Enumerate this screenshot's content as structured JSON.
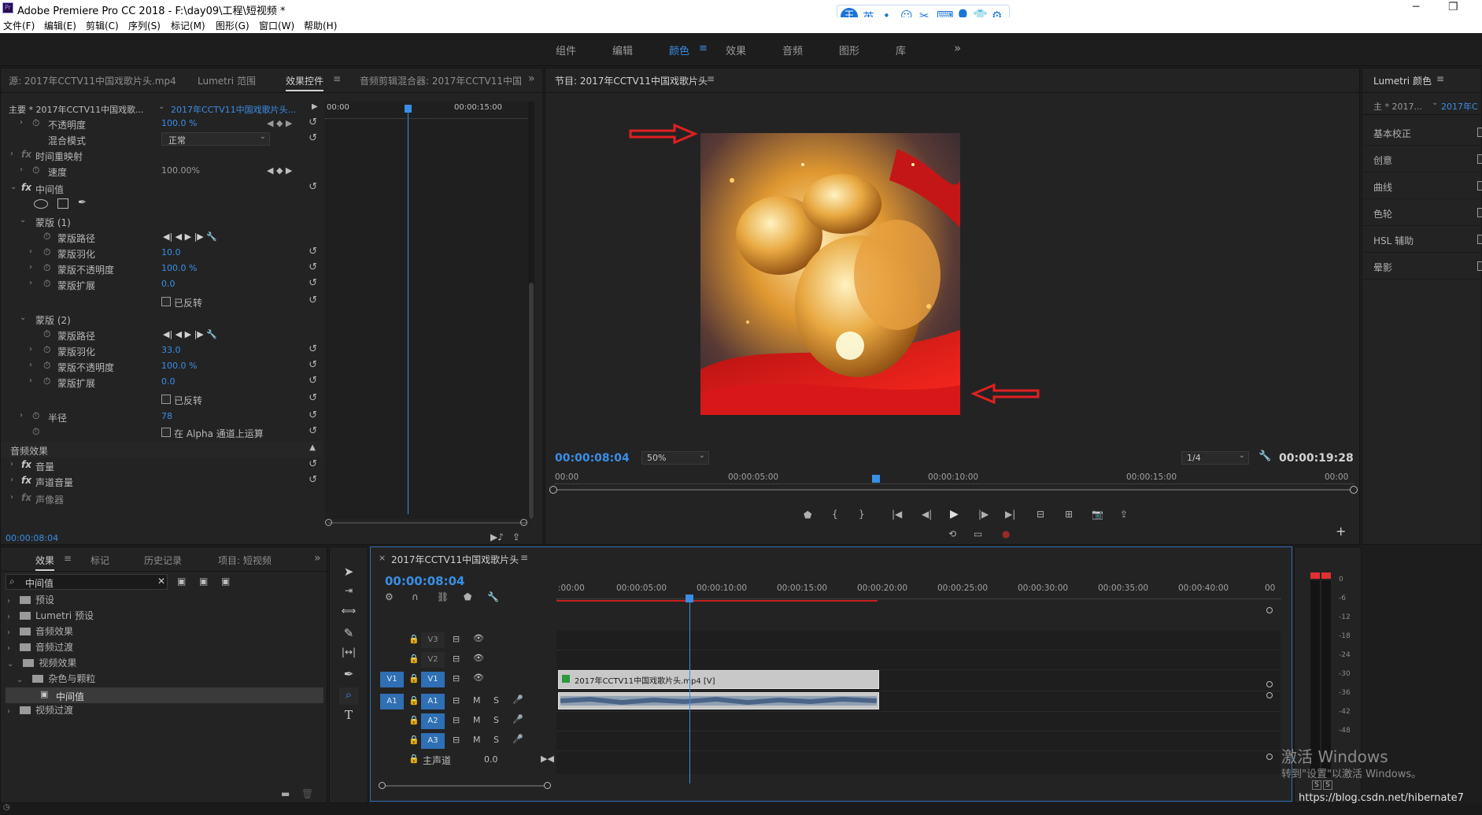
{
  "app": {
    "title": "Adobe Premiere Pro CC 2018 - F:\\day09\\工程\\短视频 *"
  },
  "menu": [
    "文件(F)",
    "编辑(E)",
    "剪辑(C)",
    "序列(S)",
    "标记(M)",
    "图形(G)",
    "窗口(W)",
    "帮助(H)"
  ],
  "ime": {
    "logo": "王",
    "items": [
      "英",
      "•,",
      "☺",
      "✂",
      "⌨",
      "👤",
      "👕",
      "⚙"
    ]
  },
  "workspaces": [
    "组件",
    "编辑",
    "颜色",
    "效果",
    "音频",
    "图形",
    "库"
  ],
  "workspace_active": "颜色",
  "workspace_more": "»",
  "source_panel": {
    "tabs": [
      "源: 2017年CCTV11中国戏歌片头.mp4",
      "Lumetri 范围",
      "效果控件",
      "音频剪辑混合器: 2017年CCTV11中国"
    ],
    "active_tab": "效果控件",
    "master_label": "主要 * 2017年CCTV11中国戏歌...",
    "clip_label": "2017年CCTV11中国戏歌片头...",
    "ruler": [
      "00:00",
      "00:00:15:00"
    ],
    "rows": {
      "opacity": {
        "label": "不透明度",
        "value": "100.0 %"
      },
      "blend": {
        "label": "混合模式",
        "value": "正常"
      },
      "time_remap": {
        "label": "时间重映射"
      },
      "speed": {
        "label": "速度",
        "value": "100.00%"
      },
      "median": {
        "label": "中间值"
      },
      "mask1": {
        "label": "蒙版 (1)"
      },
      "mask1_path": {
        "label": "蒙版路径"
      },
      "mask1_feather": {
        "label": "蒙版羽化",
        "value": "10.0"
      },
      "mask1_opacity": {
        "label": "蒙版不透明度",
        "value": "100.0 %"
      },
      "mask1_expand": {
        "label": "蒙版扩展",
        "value": "0.0"
      },
      "mask1_inverted": {
        "label": "已反转"
      },
      "mask2": {
        "label": "蒙版 (2)"
      },
      "mask2_path": {
        "label": "蒙版路径"
      },
      "mask2_feather": {
        "label": "蒙版羽化",
        "value": "33.0"
      },
      "mask2_opacity": {
        "label": "蒙版不透明度",
        "value": "100.0 %"
      },
      "mask2_expand": {
        "label": "蒙版扩展",
        "value": "0.0"
      },
      "mask2_inverted": {
        "label": "已反转"
      },
      "radius": {
        "label": "半径",
        "value": "78"
      },
      "alpha": {
        "label": "在 Alpha 通道上运算"
      },
      "audio_effects": {
        "label": "音频效果"
      },
      "volume": {
        "label": "音量"
      },
      "channel_volume": {
        "label": "声道音量"
      },
      "panner": {
        "label": "声像器"
      }
    },
    "timecode": "00:00:08:04"
  },
  "program_monitor": {
    "title": "节目: 2017年CCTV11中国戏歌片头",
    "timecode": "00:00:08:04",
    "zoom": "50%",
    "resolution": "1/4",
    "duration": "00:00:19:28",
    "ruler": [
      "00:00",
      "00:00:05:00",
      "00:00:10:00",
      "00:00:15:00",
      "00:00"
    ]
  },
  "lumetri": {
    "title": "Lumetri 颜色",
    "master": "主 * 2017...",
    "clip": "2017年C",
    "sections": [
      "基本校正",
      "创意",
      "曲线",
      "色轮",
      "HSL 辅助",
      "晕影"
    ]
  },
  "project_panel": {
    "tabs": [
      "效果",
      "标记",
      "历史记录",
      "项目: 短视频"
    ],
    "active_tab": "效果",
    "search_value": "中间值",
    "tree": [
      {
        "label": "预设",
        "depth": 0
      },
      {
        "label": "Lumetri 预设",
        "depth": 0
      },
      {
        "label": "音频效果",
        "depth": 0
      },
      {
        "label": "音频过渡",
        "depth": 0
      },
      {
        "label": "视频效果",
        "depth": 0
      },
      {
        "label": "杂色与颗粒",
        "depth": 1
      },
      {
        "label": "中间值",
        "depth": 2
      },
      {
        "label": "视频过渡",
        "depth": 0
      }
    ]
  },
  "timeline": {
    "title": "2017年CCTV11中国戏歌片头",
    "timecode": "00:00:08:04",
    "ruler": [
      ":00:00",
      "00:00:05:00",
      "00:00:10:00",
      "00:00:15:00",
      "00:00:20:00",
      "00:00:25:00",
      "00:00:30:00",
      "00:00:35:00",
      "00:00:40:00",
      "00"
    ],
    "tracks": {
      "v3": "V3",
      "v2": "V2",
      "v1": "V1",
      "v1_src": "V1",
      "a1": "A1",
      "a1_src": "A1",
      "a2": "A2",
      "a3": "A3",
      "master": "主声道",
      "master_value": "0.0",
      "m": "M",
      "s": "S"
    },
    "clip_label": "2017年CCTV11中国戏歌片头.mp4 [V]"
  },
  "meter": {
    "labels": [
      "0",
      "-6",
      "-12",
      "-18",
      "-24",
      "-30",
      "-36",
      "-42",
      "-48"
    ],
    "solo": [
      "S",
      "S"
    ]
  },
  "watermark": {
    "line1": "激活 Windows",
    "line2": "转到\"设置\"以激活 Windows。",
    "url": "https://blog.csdn.net/hibernate7"
  },
  "colors": {
    "accent": "#3a8ee6",
    "panel_bg": "#232323",
    "clip_video": "#c8c8c8",
    "clip_audio": "#c8c8c8",
    "annotation_arrow": "#e02020"
  }
}
